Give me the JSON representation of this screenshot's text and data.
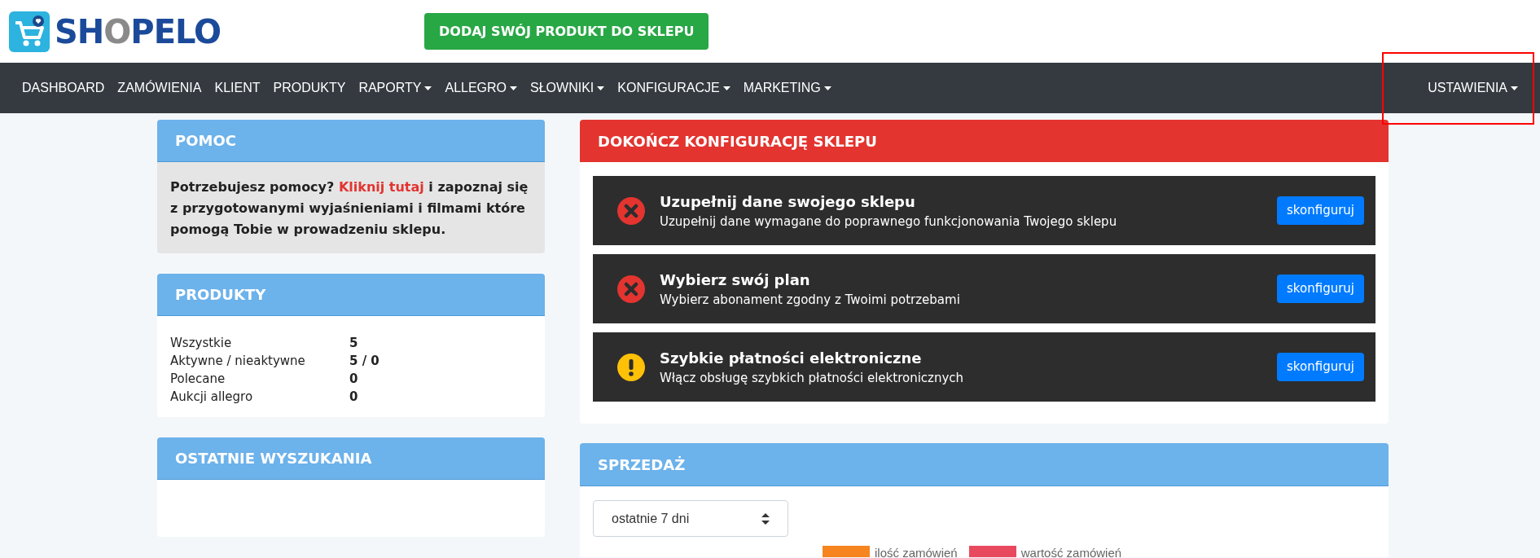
{
  "logo": {
    "text_start": "SH",
    "text_accent": "O",
    "text_end": "PELO"
  },
  "add_product_button": "DODAJ SWÓJ PRODUKT DO SKLEPU",
  "nav": {
    "items": [
      {
        "label": "DASHBOARD",
        "dropdown": false
      },
      {
        "label": "ZAMÓWIENIA",
        "dropdown": false
      },
      {
        "label": "KLIENT",
        "dropdown": false
      },
      {
        "label": "PRODUKTY",
        "dropdown": false
      },
      {
        "label": "RAPORTY",
        "dropdown": true
      },
      {
        "label": "ALLEGRO",
        "dropdown": true
      },
      {
        "label": "SŁOWNIKI",
        "dropdown": true
      },
      {
        "label": "KONFIGURACJE",
        "dropdown": true
      },
      {
        "label": "MARKETING",
        "dropdown": true
      }
    ],
    "right_item": {
      "label": "USTAWIENIA",
      "dropdown": true,
      "highlighted": true
    }
  },
  "help_panel": {
    "title": "POMOC",
    "text": "**Potrzebujesz pomocy?**",
    "link": "Kliknij tutaj",
    "text_after": "i zapoznaj się z przygotowanymi wyjaśnieniami i filmami które pomogą Tobie w prowadzeniu sklepu."
  },
  "products_panel": {
    "title": "PRODUKTY",
    "rows": [
      {
        "label": "Wszystkie",
        "value": "5"
      },
      {
        "label": "Aktywne / nieaktywne",
        "value": "5 / 0"
      },
      {
        "label": "Polecane",
        "value": "0"
      },
      {
        "label": "Aukcji allegro",
        "value": "0"
      }
    ]
  },
  "searches_panel": {
    "title": "OSTATNIE WYSZUKANIA"
  },
  "setup_panel": {
    "title": "DOKOŃCZ KONFIGURACJĘ SKLEPU",
    "tasks": [
      {
        "kind": "error",
        "title": "Uzupełnij dane swojego sklepu",
        "description": "Uzupełnij dane wymagane do poprawnego funkcjonowania Twojego sklepu",
        "button": "skonfiguruj"
      },
      {
        "kind": "error",
        "title": "Wybierz swój plan",
        "description": "Wybierz abonament zgodny z Twoimi potrzebami",
        "button": "skonfiguruj"
      },
      {
        "kind": "warning",
        "title": "Szybkie płatności elektroniczne",
        "description": "Włącz obsługę szybkich płatności elektronicznych",
        "button": "skonfiguruj"
      }
    ]
  },
  "sales_panel": {
    "title": "SPRZEDAŻ",
    "period_select": "ostatnie 7 dni",
    "legend": [
      {
        "label": "ilość zamówień",
        "color": "#f6851f"
      },
      {
        "label": "wartość zamówień",
        "color": "#e8495f"
      }
    ]
  }
}
